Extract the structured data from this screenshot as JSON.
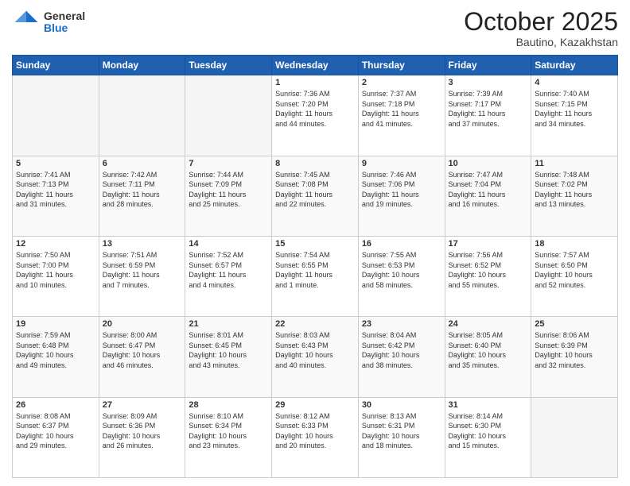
{
  "header": {
    "logo": {
      "general": "General",
      "blue": "Blue"
    },
    "title": "October 2025",
    "subtitle": "Bautino, Kazakhstan"
  },
  "days_header": [
    "Sunday",
    "Monday",
    "Tuesday",
    "Wednesday",
    "Thursday",
    "Friday",
    "Saturday"
  ],
  "weeks": [
    {
      "days": [
        {
          "num": "",
          "info": "",
          "empty": true
        },
        {
          "num": "",
          "info": "",
          "empty": true
        },
        {
          "num": "",
          "info": "",
          "empty": true
        },
        {
          "num": "1",
          "info": "Sunrise: 7:36 AM\nSunset: 7:20 PM\nDaylight: 11 hours\nand 44 minutes.",
          "empty": false
        },
        {
          "num": "2",
          "info": "Sunrise: 7:37 AM\nSunset: 7:18 PM\nDaylight: 11 hours\nand 41 minutes.",
          "empty": false
        },
        {
          "num": "3",
          "info": "Sunrise: 7:39 AM\nSunset: 7:17 PM\nDaylight: 11 hours\nand 37 minutes.",
          "empty": false
        },
        {
          "num": "4",
          "info": "Sunrise: 7:40 AM\nSunset: 7:15 PM\nDaylight: 11 hours\nand 34 minutes.",
          "empty": false
        }
      ]
    },
    {
      "days": [
        {
          "num": "5",
          "info": "Sunrise: 7:41 AM\nSunset: 7:13 PM\nDaylight: 11 hours\nand 31 minutes.",
          "empty": false
        },
        {
          "num": "6",
          "info": "Sunrise: 7:42 AM\nSunset: 7:11 PM\nDaylight: 11 hours\nand 28 minutes.",
          "empty": false
        },
        {
          "num": "7",
          "info": "Sunrise: 7:44 AM\nSunset: 7:09 PM\nDaylight: 11 hours\nand 25 minutes.",
          "empty": false
        },
        {
          "num": "8",
          "info": "Sunrise: 7:45 AM\nSunset: 7:08 PM\nDaylight: 11 hours\nand 22 minutes.",
          "empty": false
        },
        {
          "num": "9",
          "info": "Sunrise: 7:46 AM\nSunset: 7:06 PM\nDaylight: 11 hours\nand 19 minutes.",
          "empty": false
        },
        {
          "num": "10",
          "info": "Sunrise: 7:47 AM\nSunset: 7:04 PM\nDaylight: 11 hours\nand 16 minutes.",
          "empty": false
        },
        {
          "num": "11",
          "info": "Sunrise: 7:48 AM\nSunset: 7:02 PM\nDaylight: 11 hours\nand 13 minutes.",
          "empty": false
        }
      ]
    },
    {
      "days": [
        {
          "num": "12",
          "info": "Sunrise: 7:50 AM\nSunset: 7:00 PM\nDaylight: 11 hours\nand 10 minutes.",
          "empty": false
        },
        {
          "num": "13",
          "info": "Sunrise: 7:51 AM\nSunset: 6:59 PM\nDaylight: 11 hours\nand 7 minutes.",
          "empty": false
        },
        {
          "num": "14",
          "info": "Sunrise: 7:52 AM\nSunset: 6:57 PM\nDaylight: 11 hours\nand 4 minutes.",
          "empty": false
        },
        {
          "num": "15",
          "info": "Sunrise: 7:54 AM\nSunset: 6:55 PM\nDaylight: 11 hours\nand 1 minute.",
          "empty": false
        },
        {
          "num": "16",
          "info": "Sunrise: 7:55 AM\nSunset: 6:53 PM\nDaylight: 10 hours\nand 58 minutes.",
          "empty": false
        },
        {
          "num": "17",
          "info": "Sunrise: 7:56 AM\nSunset: 6:52 PM\nDaylight: 10 hours\nand 55 minutes.",
          "empty": false
        },
        {
          "num": "18",
          "info": "Sunrise: 7:57 AM\nSunset: 6:50 PM\nDaylight: 10 hours\nand 52 minutes.",
          "empty": false
        }
      ]
    },
    {
      "days": [
        {
          "num": "19",
          "info": "Sunrise: 7:59 AM\nSunset: 6:48 PM\nDaylight: 10 hours\nand 49 minutes.",
          "empty": false
        },
        {
          "num": "20",
          "info": "Sunrise: 8:00 AM\nSunset: 6:47 PM\nDaylight: 10 hours\nand 46 minutes.",
          "empty": false
        },
        {
          "num": "21",
          "info": "Sunrise: 8:01 AM\nSunset: 6:45 PM\nDaylight: 10 hours\nand 43 minutes.",
          "empty": false
        },
        {
          "num": "22",
          "info": "Sunrise: 8:03 AM\nSunset: 6:43 PM\nDaylight: 10 hours\nand 40 minutes.",
          "empty": false
        },
        {
          "num": "23",
          "info": "Sunrise: 8:04 AM\nSunset: 6:42 PM\nDaylight: 10 hours\nand 38 minutes.",
          "empty": false
        },
        {
          "num": "24",
          "info": "Sunrise: 8:05 AM\nSunset: 6:40 PM\nDaylight: 10 hours\nand 35 minutes.",
          "empty": false
        },
        {
          "num": "25",
          "info": "Sunrise: 8:06 AM\nSunset: 6:39 PM\nDaylight: 10 hours\nand 32 minutes.",
          "empty": false
        }
      ]
    },
    {
      "days": [
        {
          "num": "26",
          "info": "Sunrise: 8:08 AM\nSunset: 6:37 PM\nDaylight: 10 hours\nand 29 minutes.",
          "empty": false
        },
        {
          "num": "27",
          "info": "Sunrise: 8:09 AM\nSunset: 6:36 PM\nDaylight: 10 hours\nand 26 minutes.",
          "empty": false
        },
        {
          "num": "28",
          "info": "Sunrise: 8:10 AM\nSunset: 6:34 PM\nDaylight: 10 hours\nand 23 minutes.",
          "empty": false
        },
        {
          "num": "29",
          "info": "Sunrise: 8:12 AM\nSunset: 6:33 PM\nDaylight: 10 hours\nand 20 minutes.",
          "empty": false
        },
        {
          "num": "30",
          "info": "Sunrise: 8:13 AM\nSunset: 6:31 PM\nDaylight: 10 hours\nand 18 minutes.",
          "empty": false
        },
        {
          "num": "31",
          "info": "Sunrise: 8:14 AM\nSunset: 6:30 PM\nDaylight: 10 hours\nand 15 minutes.",
          "empty": false
        },
        {
          "num": "",
          "info": "",
          "empty": true
        }
      ]
    }
  ]
}
